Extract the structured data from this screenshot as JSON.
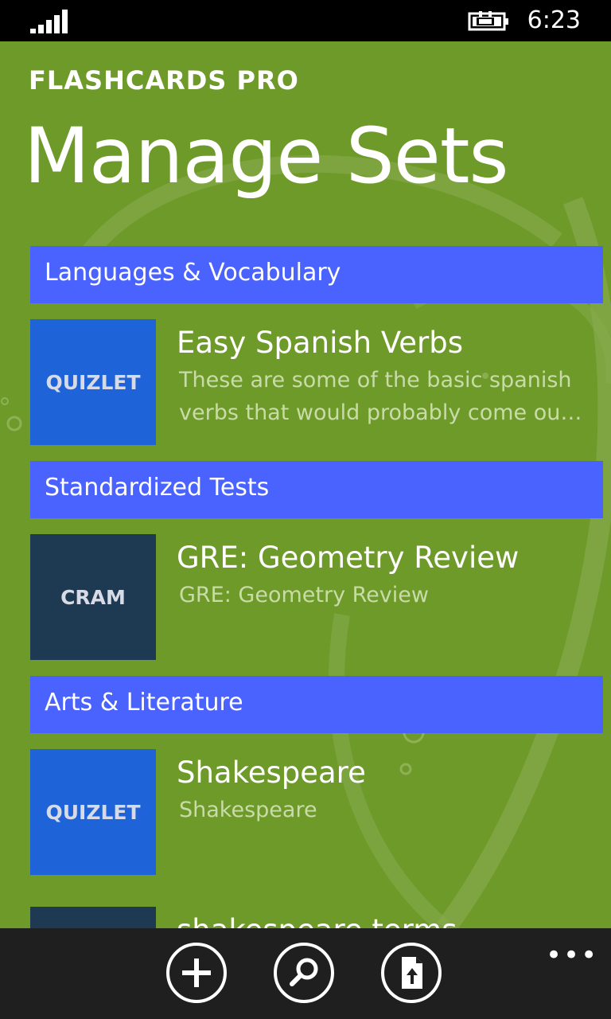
{
  "status_bar": {
    "time": "6:23"
  },
  "header": {
    "app_name": "FLASHCARDS PRO",
    "title": "Manage Sets"
  },
  "groups": [
    {
      "category": "Languages & Vocabulary",
      "items": [
        {
          "source": "QUIZLET",
          "title": "Easy Spanish Verbs",
          "desc_line1": "These are some of the basic spanish",
          "desc_line2": "verbs that would probably come out on an exam"
        }
      ]
    },
    {
      "category": "Standardized Tests",
      "items": [
        {
          "source": "CRAM",
          "title": "GRE: Geometry Review",
          "desc_line1": "GRE: Geometry Review"
        }
      ]
    },
    {
      "category": "Arts & Literature",
      "items": [
        {
          "source": "QUIZLET",
          "title": "Shakespeare",
          "desc_line1": "Shakespeare"
        },
        {
          "source": "",
          "title": "shakespeare terms"
        }
      ]
    }
  ],
  "appbar": {
    "buttons": [
      "add-icon",
      "search-icon",
      "import-icon"
    ],
    "more": "•••"
  },
  "colors": {
    "background": "#6e9a2a",
    "category_header": "#4a63ff",
    "quizlet_tile": "#1f63d8",
    "cram_tile": "#1e3a52"
  }
}
